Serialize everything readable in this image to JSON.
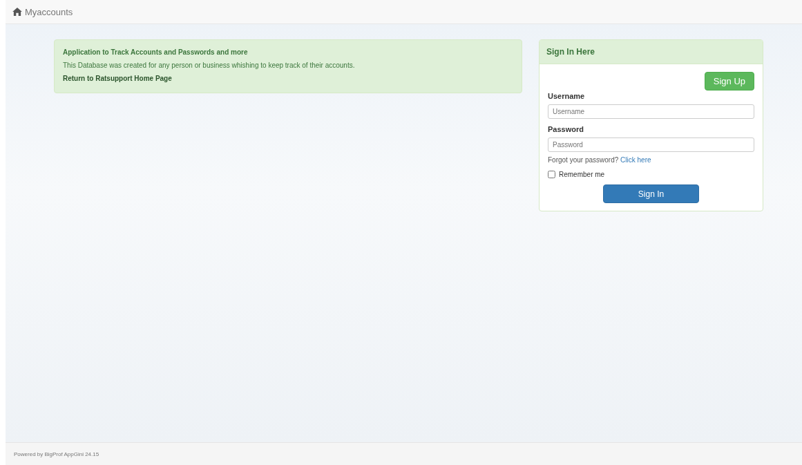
{
  "navbar": {
    "brand": "Myaccounts"
  },
  "info_panel": {
    "title": "Application to Track Accounts and Passwords and more",
    "text": "This Database was created for any person or business whishing to keep track of their accounts.",
    "link": "Return to Ratsupport Home Page"
  },
  "sign_in": {
    "title": "Sign In Here",
    "sign_up_button": "Sign Up",
    "username_label": "Username",
    "username_placeholder": "Username",
    "password_label": "Password",
    "password_placeholder": "Password",
    "forgot_text": "Forgot your password?",
    "forgot_link": "Click here",
    "remember_label": "Remember me",
    "remember_checked": false,
    "sign_in_button": "Sign In"
  },
  "footer": {
    "text": "Powered by BigProf AppGini 24.15"
  }
}
